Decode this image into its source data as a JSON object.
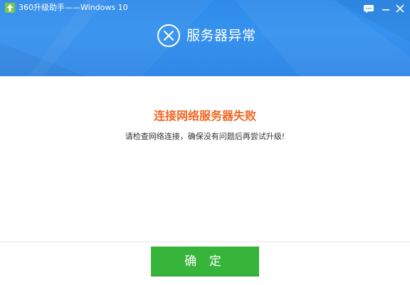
{
  "window": {
    "title": "360升级助手——Windows 10",
    "header_color": "#3692ee",
    "icons": {
      "app": "upgrade-arrow-icon",
      "feedback": "chat-bubble-icon",
      "minimize": "minimize-icon",
      "close": "close-icon"
    }
  },
  "header": {
    "status_icon": "circle-x-icon",
    "status_title": "服务器异常"
  },
  "content": {
    "error_heading": "连接网络服务器失败",
    "error_heading_color": "#f26522",
    "error_message": "请检查网络连接，确保没有问题后再尝试升级!"
  },
  "footer": {
    "confirm_label": "确 定",
    "confirm_color": "#36b53a"
  }
}
